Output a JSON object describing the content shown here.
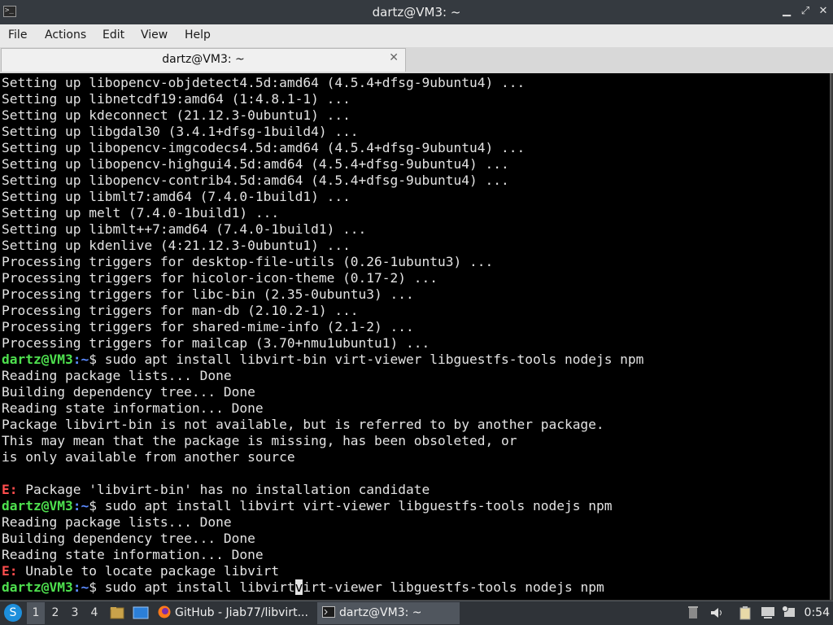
{
  "window": {
    "title": "dartz@VM3: ~",
    "controls": {
      "minimize": "▁",
      "maximize": "⤢",
      "close": "✕"
    }
  },
  "menu": [
    "File",
    "Actions",
    "Edit",
    "View",
    "Help"
  ],
  "tab": {
    "label": "dartz@VM3: ~",
    "close": "✕"
  },
  "terminal": {
    "user": "dartz@VM3",
    "path": ":~",
    "lines": [
      {
        "text": "Setting up libopencv-objdetect4.5d:amd64 (4.5.4+dfsg-9ubuntu4) ..."
      },
      {
        "text": "Setting up libnetcdf19:amd64 (1:4.8.1-1) ..."
      },
      {
        "text": "Setting up kdeconnect (21.12.3-0ubuntu1) ..."
      },
      {
        "text": "Setting up libgdal30 (3.4.1+dfsg-1build4) ..."
      },
      {
        "text": "Setting up libopencv-imgcodecs4.5d:amd64 (4.5.4+dfsg-9ubuntu4) ..."
      },
      {
        "text": "Setting up libopencv-highgui4.5d:amd64 (4.5.4+dfsg-9ubuntu4) ..."
      },
      {
        "text": "Setting up libopencv-contrib4.5d:amd64 (4.5.4+dfsg-9ubuntu4) ..."
      },
      {
        "text": "Setting up libmlt7:amd64 (7.4.0-1build1) ..."
      },
      {
        "text": "Setting up melt (7.4.0-1build1) ..."
      },
      {
        "text": "Setting up libmlt++7:amd64 (7.4.0-1build1) ..."
      },
      {
        "text": "Setting up kdenlive (4:21.12.3-0ubuntu1) ..."
      },
      {
        "text": "Processing triggers for desktop-file-utils (0.26-1ubuntu3) ..."
      },
      {
        "text": "Processing triggers for hicolor-icon-theme (0.17-2) ..."
      },
      {
        "text": "Processing triggers for libc-bin (2.35-0ubuntu3) ..."
      },
      {
        "text": "Processing triggers for man-db (2.10.2-1) ..."
      },
      {
        "text": "Processing triggers for shared-mime-info (2.1-2) ..."
      },
      {
        "text": "Processing triggers for mailcap (3.70+nmu1ubuntu1) ..."
      },
      {
        "prompt": true,
        "text": "$ sudo apt install libvirt-bin virt-viewer libguestfs-tools nodejs npm"
      },
      {
        "text": "Reading package lists... Done"
      },
      {
        "text": "Building dependency tree... Done"
      },
      {
        "text": "Reading state information... Done"
      },
      {
        "text": "Package libvirt-bin is not available, but is referred to by another package."
      },
      {
        "text": "This may mean that the package is missing, has been obsoleted, or"
      },
      {
        "text": "is only available from another source"
      },
      {
        "text": ""
      },
      {
        "error": "E:",
        "text": " Package 'libvirt-bin' has no installation candidate"
      },
      {
        "prompt": true,
        "text": "$ sudo apt install libvirt virt-viewer libguestfs-tools nodejs npm"
      },
      {
        "text": "Reading package lists... Done"
      },
      {
        "text": "Building dependency tree... Done"
      },
      {
        "text": "Reading state information... Done"
      },
      {
        "error": "E:",
        "text": " Unable to locate package libvirt"
      },
      {
        "prompt": true,
        "text": "$ sudo apt install libvirt",
        "cursor": "v",
        "after": "irt-viewer libguestfs-tools nodejs npm"
      }
    ]
  },
  "taskbar": {
    "workspaces": [
      "1",
      "2",
      "3",
      "4"
    ],
    "active_workspace": "1",
    "tasks": [
      {
        "label": "GitHub - Jiab77/libvirt...",
        "icon": "firefox-icon"
      },
      {
        "label": "dartz@VM3: ~",
        "icon": "terminal-icon"
      }
    ],
    "clock": "0:54",
    "colors": {
      "panel": "#2f3338",
      "active": "#50565e",
      "accent": "#1d8fdc"
    }
  }
}
